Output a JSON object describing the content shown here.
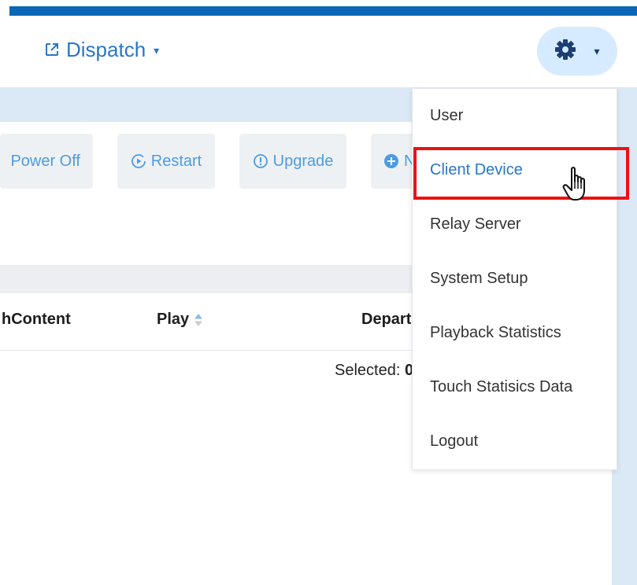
{
  "header": {
    "dispatch_label": "Dispatch",
    "dispatch_caret": "▾",
    "gear_caret": "▾"
  },
  "toolbar": {
    "power_off_label": "Power Off",
    "restart_label": "Restart",
    "upgrade_label": "Upgrade",
    "new_label": "N"
  },
  "table": {
    "columns": [
      "hContent",
      "Play",
      "Depart"
    ]
  },
  "selection": {
    "prefix": "Selected: ",
    "count": "0"
  },
  "menu": {
    "items": [
      {
        "label": "User"
      },
      {
        "label": "Client Device"
      },
      {
        "label": "Relay Server"
      },
      {
        "label": "System Setup"
      },
      {
        "label": "Playback Statistics"
      },
      {
        "label": "Touch Statisics Data"
      },
      {
        "label": "Logout"
      }
    ],
    "active_index": 1
  },
  "colors": {
    "accent": "#2a76c7",
    "top_bar": "#0b67b5",
    "highlight": "#ee1111",
    "gear_button_bg": "#d6ebff"
  },
  "icons": {
    "dispatch": "external-link-icon",
    "settings": "gear-icon",
    "restart": "play-circle-icon",
    "upgrade": "exclamation-circle-icon",
    "new": "plus-circle-icon",
    "sort": "sort-icon",
    "cursor": "hand-pointer-icon"
  }
}
